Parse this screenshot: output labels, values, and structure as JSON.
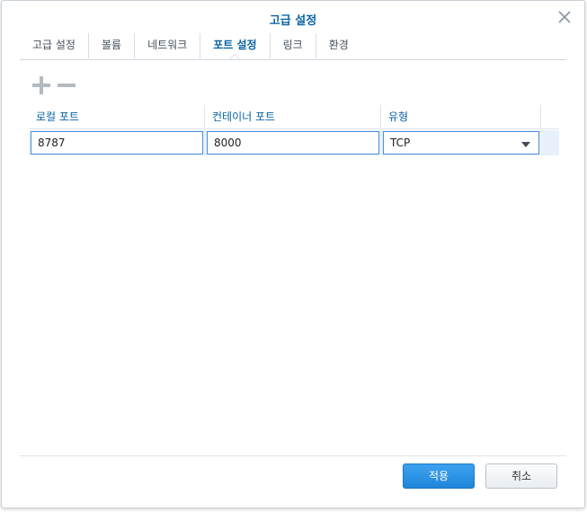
{
  "dialog": {
    "title": "고급 설정"
  },
  "tabs": [
    {
      "label": "고급 설정",
      "active": false
    },
    {
      "label": "볼륨",
      "active": false
    },
    {
      "label": "네트워크",
      "active": false
    },
    {
      "label": "포트 설정",
      "active": true
    },
    {
      "label": "링크",
      "active": false
    },
    {
      "label": "환경",
      "active": false
    }
  ],
  "toolbar": {
    "add_icon": "plus-icon",
    "remove_icon": "minus-icon"
  },
  "table": {
    "headers": [
      "로컬 포트",
      "컨테이너 포트",
      "유형"
    ],
    "rows": [
      {
        "local_port": "8787",
        "container_port": "8000",
        "type": "TCP"
      }
    ]
  },
  "footer": {
    "apply_label": "적용",
    "cancel_label": "취소"
  },
  "colors": {
    "accent": "#0a64a6",
    "primary_button": "#1e86da",
    "selected_row": "#e8f1fb"
  }
}
